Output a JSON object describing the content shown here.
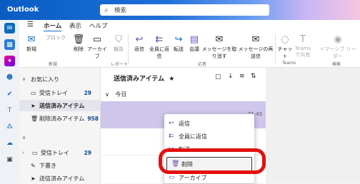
{
  "app": {
    "title": "Outlook"
  },
  "search": {
    "placeholder": "検索"
  },
  "tabs": [
    {
      "label": "ホーム"
    },
    {
      "label": "表示"
    },
    {
      "label": "ヘルプ"
    }
  ],
  "ribbon": {
    "new_label": "新規",
    "new_mail_label": "新規",
    "block_label": "ブロック",
    "delete_label": "削除",
    "archive_label": "アーカイブ",
    "report_label": "報告",
    "reply_label": "返信",
    "reply_all_label": "全員に返信",
    "forward_label": "転送",
    "meeting_label": "会議",
    "recall_label": "メッセージを取り消す",
    "resend_label": "メッセージの再送信",
    "chat_label": "チャット",
    "teams_label": "Teams\nで共有",
    "immersive_label": "イマーシブ リーダー",
    "groups": {
      "new": "新規",
      "delete": "削除",
      "report": "レポート",
      "respond": "応答",
      "teams": "Teams",
      "find": "検索"
    }
  },
  "folders": {
    "favorites_label": "お気に入り",
    "items": [
      {
        "label": "受信トレイ",
        "count": "29"
      },
      {
        "label": "送信済みアイテム",
        "count": ""
      },
      {
        "label": "削除済みアイテム",
        "count": "958"
      }
    ],
    "account_items": [
      {
        "label": "受信トレイ",
        "count": "29"
      },
      {
        "label": "下書き",
        "count": ""
      },
      {
        "label": "送信済みアイテム",
        "count": ""
      }
    ]
  },
  "list": {
    "title": "送信済みアイテム",
    "group_today": "今日",
    "time": "21:43"
  },
  "context_menu": {
    "items": [
      {
        "label": "返信"
      },
      {
        "label": "全員に返信"
      },
      {
        "label": "転送"
      },
      {
        "label": "削除"
      },
      {
        "label": "アーカイブ"
      }
    ]
  },
  "colors": {
    "accent": "#0f6cbd",
    "highlight": "#e3100f",
    "selected": "#cfc6ec"
  }
}
